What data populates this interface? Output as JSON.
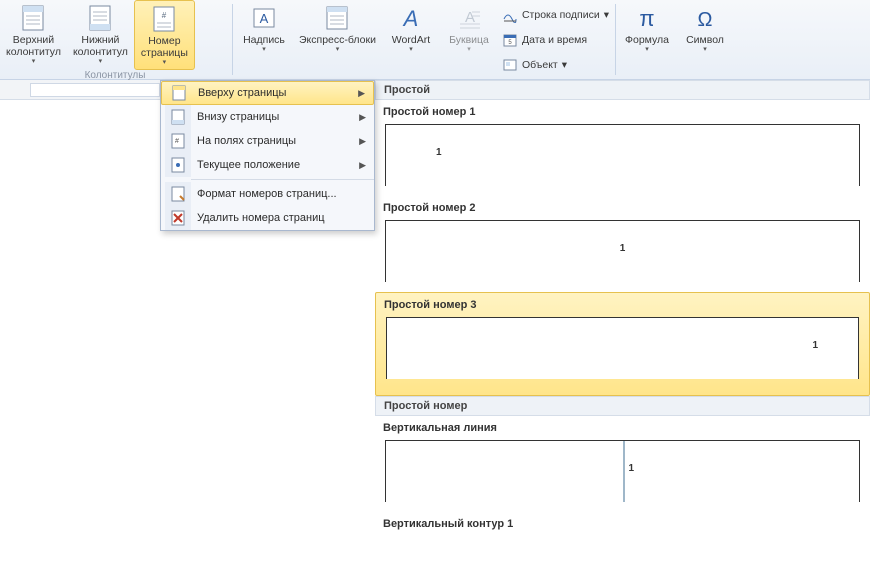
{
  "ribbon": {
    "group_label": "Колонтитулы",
    "buttons": {
      "header": "Верхний\nколонтитул",
      "footer": "Нижний\nколонтитул",
      "page_number": "Номер\nстраницы",
      "textbox": "Надпись",
      "quickparts": "Экспресс-блоки",
      "wordart": "WordArt",
      "dropcap": "Буквица",
      "equation": "Формула",
      "symbol": "Символ"
    },
    "small": {
      "signature": "Строка подписи",
      "datetime": "Дата и время",
      "object": "Объект"
    }
  },
  "menu": {
    "top": "Вверху страницы",
    "bottom": "Внизу страницы",
    "margins": "На полях страницы",
    "current": "Текущее положение",
    "format": "Формат номеров страниц...",
    "remove": "Удалить номера страниц"
  },
  "gallery": {
    "section1": "Простой",
    "item1": "Простой номер 1",
    "item2": "Простой номер 2",
    "item3": "Простой номер 3",
    "section2": "Простой номер",
    "item4": "Вертикальная линия",
    "item5": "Вертикальный контур 1",
    "digit": "1"
  }
}
